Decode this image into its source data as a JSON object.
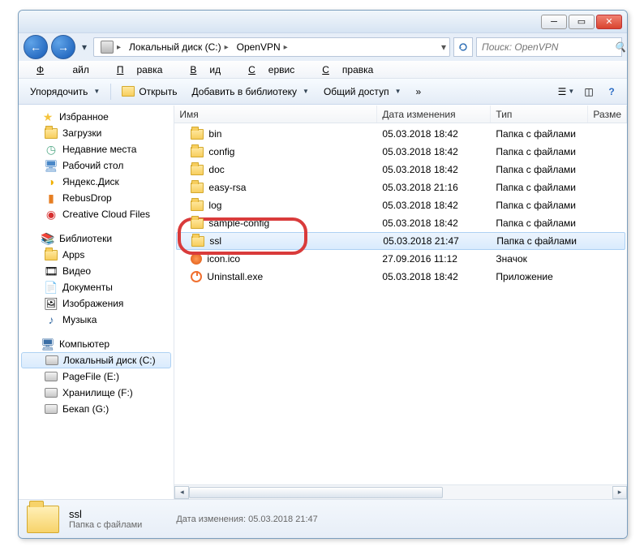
{
  "breadcrumb": {
    "seg1": "Локальный диск (C:)",
    "seg2": "OpenVPN"
  },
  "search": {
    "placeholder": "Поиск: OpenVPN"
  },
  "menu": {
    "file": "Файл",
    "edit": "Правка",
    "view": "Вид",
    "tools": "Сервис",
    "help": "Справка"
  },
  "toolbar": {
    "organize": "Упорядочить",
    "open": "Открыть",
    "addlib": "Добавить в библиотеку",
    "share": "Общий доступ"
  },
  "columns": {
    "name": "Имя",
    "date": "Дата изменения",
    "type": "Тип",
    "size": "Разме"
  },
  "sidebar": {
    "fav": "Избранное",
    "fav_items": {
      "downloads": "Загрузки",
      "recent": "Недавние места",
      "desktop": "Рабочий стол",
      "yandex": "Яндекс.Диск",
      "rebus": "RebusDrop",
      "ccf": "Creative Cloud Files"
    },
    "lib": "Библиотеки",
    "lib_items": {
      "apps": "Apps",
      "video": "Видео",
      "docs": "Документы",
      "images": "Изображения",
      "music": "Музыка"
    },
    "pc": "Компьютер",
    "pc_items": {
      "c": "Локальный диск (C:)",
      "p": "PageFile (E:)",
      "h": "Хранилище (F:)",
      "b": "Бекап (G:)"
    }
  },
  "rows": [
    {
      "name": "bin",
      "date": "05.03.2018 18:42",
      "type": "Папка с файлами",
      "kind": "folder"
    },
    {
      "name": "config",
      "date": "05.03.2018 18:42",
      "type": "Папка с файлами",
      "kind": "folder"
    },
    {
      "name": "doc",
      "date": "05.03.2018 18:42",
      "type": "Папка с файлами",
      "kind": "folder"
    },
    {
      "name": "easy-rsa",
      "date": "05.03.2018 21:16",
      "type": "Папка с файлами",
      "kind": "folder"
    },
    {
      "name": "log",
      "date": "05.03.2018 18:42",
      "type": "Папка с файлами",
      "kind": "folder"
    },
    {
      "name": "sample-config",
      "date": "05.03.2018 18:42",
      "type": "Папка с файлами",
      "kind": "folder"
    },
    {
      "name": "ssl",
      "date": "05.03.2018 21:47",
      "type": "Папка с файлами",
      "kind": "folder"
    },
    {
      "name": "icon.ico",
      "date": "27.09.2016 11:12",
      "type": "Значок",
      "kind": "icon"
    },
    {
      "name": "Uninstall.exe",
      "date": "05.03.2018 18:42",
      "type": "Приложение",
      "kind": "exe"
    }
  ],
  "status": {
    "name": "ssl",
    "type": "Папка с файлами",
    "meta_label": "Дата изменения:",
    "meta_value": "05.03.2018 21:47"
  }
}
